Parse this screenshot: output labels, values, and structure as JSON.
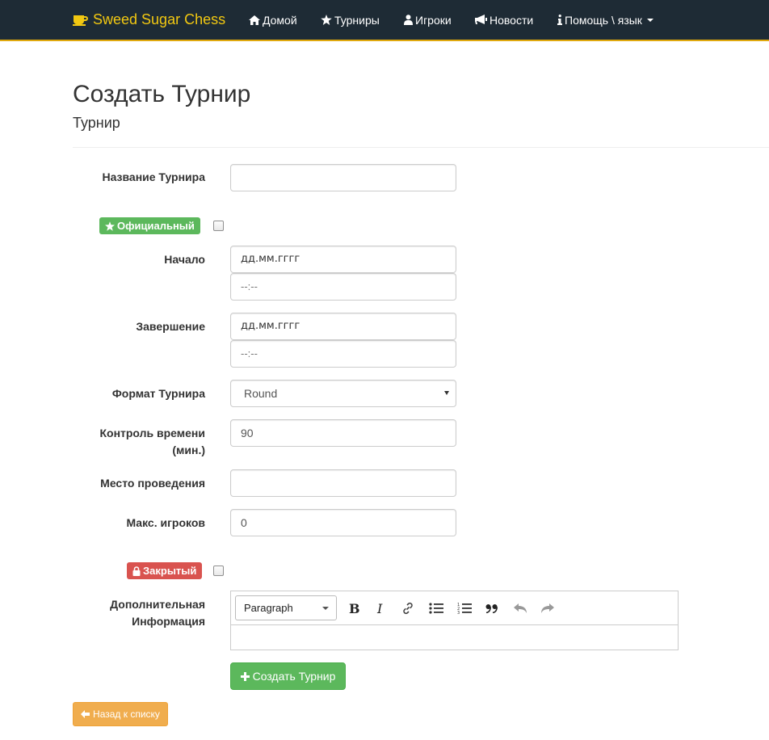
{
  "colors": {
    "navbar_bg": "#1e2b35",
    "brand": "#f2c811",
    "official_badge": "#5cb85c",
    "closed_badge": "#d9534f",
    "create_button": "#5cb85c",
    "back_button": "#f0ad4e"
  },
  "navbar": {
    "brand": "Sweed Sugar Chess",
    "brand_icon": "coffee-cup-icon",
    "items": [
      {
        "label": "Домой",
        "icon": "home-icon"
      },
      {
        "label": "Турниры",
        "icon": "star-icon"
      },
      {
        "label": "Игроки",
        "icon": "user-icon"
      },
      {
        "label": "Новости",
        "icon": "bullhorn-icon"
      },
      {
        "label": "Помощь \\ язык",
        "icon": "info-icon",
        "dropdown": true
      }
    ]
  },
  "header": {
    "title": "Создать Турнир",
    "subtitle": "Турнир"
  },
  "form": {
    "name_label": "Название Турнира",
    "name_value": "",
    "official_label": "Официальный",
    "official_checked": false,
    "start_label": "Начало",
    "start_date_placeholder": "дд.мм.гггг",
    "start_time_placeholder": "--:--",
    "end_label": "Завершение",
    "end_date_placeholder": "дд.мм.гггг",
    "end_time_placeholder": "--:--",
    "format_label": "Формат Турнира",
    "format_value": "Round",
    "time_control_label_line1": "Контроль времени",
    "time_control_label_line2": "(мин.)",
    "time_control_value": "90",
    "venue_label": "Место проведения",
    "venue_value": "",
    "max_players_label": "Макс. игроков",
    "max_players_value": "0",
    "closed_label": "Закрытый",
    "closed_checked": false,
    "info_label_line1": "Дополнительная",
    "info_label_line2": "Информация",
    "editor_format": "Paragraph",
    "submit_label": "Создать Турнир"
  },
  "back_label": "Назад к списку"
}
